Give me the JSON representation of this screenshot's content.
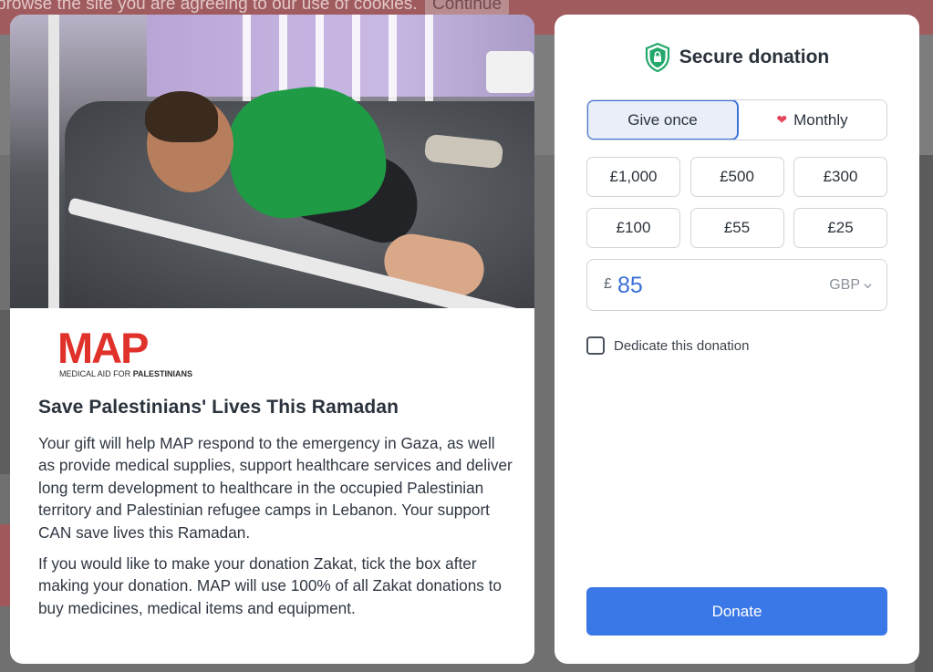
{
  "background": {
    "cookie_text": "browse the site you are agreeing to our use of cookies.",
    "cookie_button": "Continue"
  },
  "campaign": {
    "logo_text": "MAP",
    "logo_subtitle_prefix": "MEDICAL AID FOR",
    "logo_subtitle_bold": "PALESTINIANS",
    "title": "Save Palestinians' Lives This Ramadan",
    "paragraphs": [
      "Your gift will help MAP respond to the emergency in Gaza, as well as provide medical supplies, support healthcare services and deliver long term development to healthcare in the occupied Palestinian territory and Palestinian refugee camps in Lebanon. Your support CAN save lives this Ramadan.",
      "If you would like to make your donation Zakat, tick the box after making your donation. MAP will use 100% of all Zakat donations to buy medicines, medical items and equipment."
    ]
  },
  "donation": {
    "header": "Secure donation",
    "frequency": {
      "options": [
        "Give once",
        "Monthly"
      ],
      "selected": "Give once"
    },
    "amounts": [
      "£1,000",
      "£500",
      "£300",
      "£100",
      "£55",
      "£25"
    ],
    "currency_symbol": "£",
    "custom_amount": "85",
    "currency": "GBP",
    "dedicate_label": "Dedicate this donation",
    "dedicate_checked": false,
    "donate_label": "Donate"
  },
  "colors": {
    "accent": "#3b78e7",
    "brand_red": "#e1312b",
    "shield": "#22a86b",
    "heart": "#e2465a"
  },
  "icons": [
    "shield-lock-icon",
    "heart-icon",
    "chevron-down-icon"
  ]
}
